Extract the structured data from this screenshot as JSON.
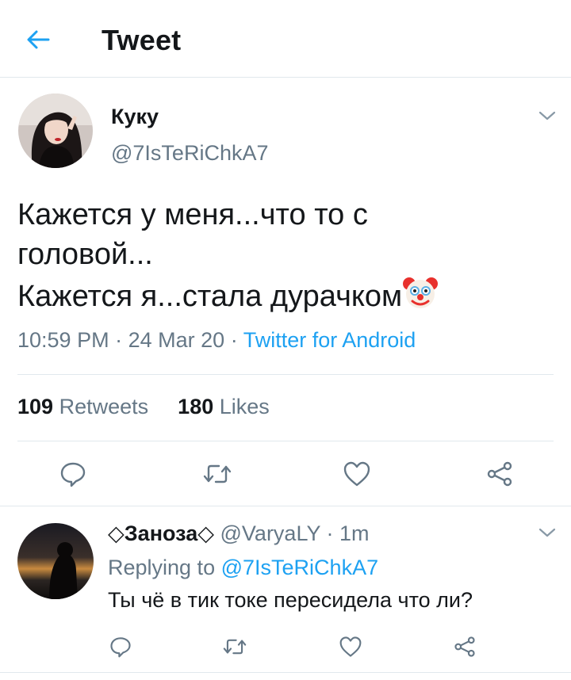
{
  "header": {
    "title": "Tweet"
  },
  "tweet": {
    "author_name": "Куку",
    "author_handle": "@7IsTeRiChkA7",
    "text_lines": [
      "Кажется у меня...что то с",
      "головой...",
      "Кажется я...стала дурачком"
    ],
    "emoji": "clown-face",
    "time": "10:59 PM",
    "date": "24 Mar 20",
    "source": "Twitter for Android",
    "retweets_count": "109",
    "retweets_label": "Retweets",
    "likes_count": "180",
    "likes_label": "Likes"
  },
  "reply": {
    "author_name": "◇Заноза◇",
    "author_handle": "@VaryaLY",
    "time_ago": "1m",
    "replying_label": "Replying to",
    "replying_to": "@7IsTeRiChkA7",
    "text": "Ты чё в тик токе пересидела что ли?"
  },
  "icons": [
    "back-arrow-icon",
    "chevron-down-icon",
    "reply-icon",
    "retweet-icon",
    "like-icon",
    "share-icon"
  ],
  "colors": {
    "accent": "#1da1f2",
    "text": "#14171a",
    "muted": "#657786",
    "divider": "#e1e8ed"
  }
}
